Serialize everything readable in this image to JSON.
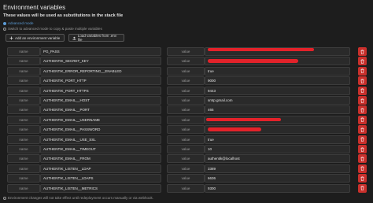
{
  "header": {
    "title": "Environment variables",
    "subtitle": "These values will be used as substitutions in the stack file",
    "advanced_mode": "Advanced mode",
    "advanced_hint": "Switch to advanced mode to copy & paste multiple variables"
  },
  "toolbar": {
    "add_label": "Add an environment variable",
    "load_label": "Load variables from .env file"
  },
  "labels": {
    "name": "name",
    "value": "value"
  },
  "variables": [
    {
      "name": "PG_PASS",
      "value": ""
    },
    {
      "name": "AUTHENTIK_SECRET_KEY",
      "value": ""
    },
    {
      "name": "AUTHENTIK_ERROR_REPORTING__ENABLED",
      "value": "true"
    },
    {
      "name": "AUTHENTIK_PORT_HTTP",
      "value": "9000"
    },
    {
      "name": "AUTHENTIK_PORT_HTTPS",
      "value": "9443"
    },
    {
      "name": "AUTHENTIK_EMAIL__HOST",
      "value": "smtp.gmail.com"
    },
    {
      "name": "AUTHENTIK_EMAIL__PORT",
      "value": "465"
    },
    {
      "name": "AUTHENTIK_EMAIL__USERNAME",
      "value": ""
    },
    {
      "name": "AUTHENTIK_EMAIL__PASSWORD",
      "value": ""
    },
    {
      "name": "AUTHENTIK_EMAIL__USE_SSL",
      "value": "true"
    },
    {
      "name": "AUTHENTIK_EMAIL__TIMEOUT",
      "value": "10"
    },
    {
      "name": "AUTHENTIK_EMAIL__FROM",
      "value": "authentik@localhost"
    },
    {
      "name": "AUTHENTIK_LISTEN__LDAP",
      "value": "3389"
    },
    {
      "name": "AUTHENTIK_LISTEN__LDAPS",
      "value": "6636"
    },
    {
      "name": "AUTHENTIK_LISTEN__METRICS",
      "value": "9300"
    }
  ],
  "footer": {
    "note": "Environment changes will not take effect until redeployment occurs manually or via webhook."
  },
  "colors": {
    "delete": "#c9302c",
    "accent": "#5b9bd5",
    "redaction": "#e3222a"
  },
  "icons": [
    "plus-icon",
    "upload-icon",
    "trash-icon",
    "info-icon"
  ]
}
